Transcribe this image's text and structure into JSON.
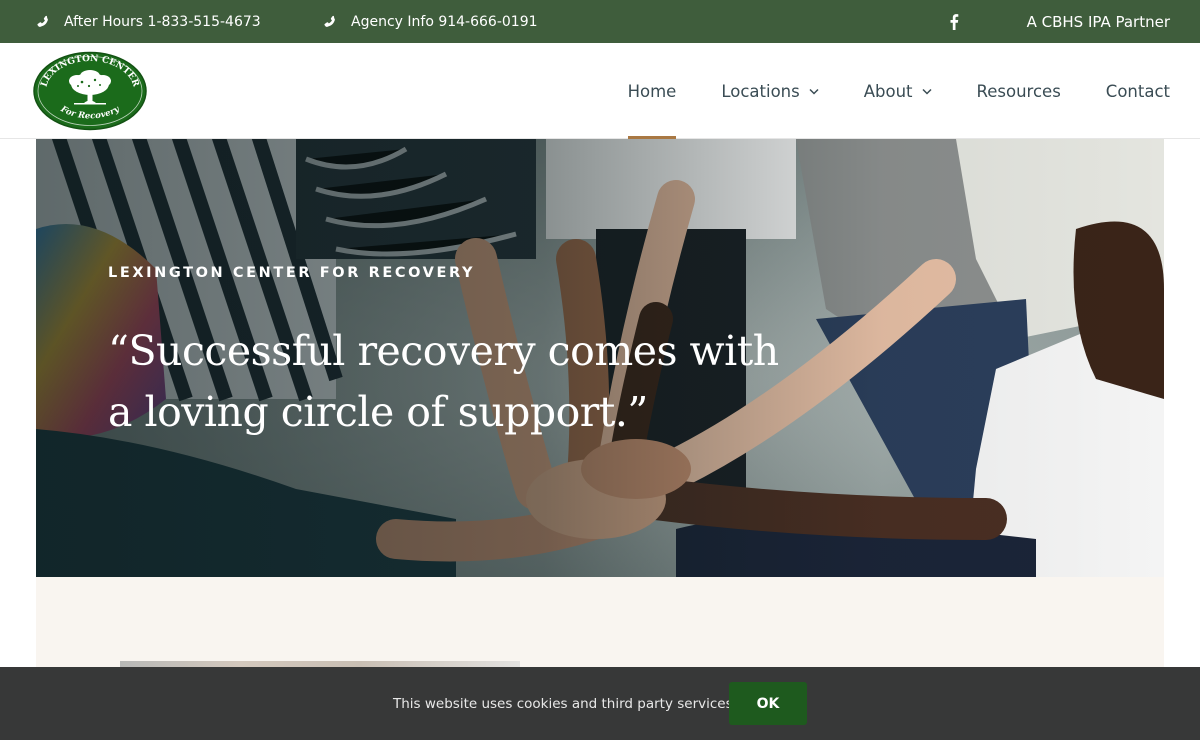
{
  "topbar": {
    "after_hours": "After Hours 1-833-515-4673",
    "agency_info": "Agency Info 914-666-0191",
    "partner": "A CBHS IPA Partner",
    "icons": [
      "phone-icon",
      "phone-icon",
      "facebook-icon"
    ]
  },
  "logo": {
    "top_text": "LEXINGTON CENTER",
    "bottom_text": "For Recovery"
  },
  "nav": {
    "items": [
      {
        "label": "Home",
        "active": true,
        "dropdown": false
      },
      {
        "label": "Locations",
        "active": false,
        "dropdown": true
      },
      {
        "label": "About",
        "active": false,
        "dropdown": true
      },
      {
        "label": "Resources",
        "active": false,
        "dropdown": false
      },
      {
        "label": "Contact",
        "active": false,
        "dropdown": false
      }
    ]
  },
  "hero": {
    "kicker": "LEXINGTON CENTER FOR RECOVERY",
    "quote_line1": "“Successful recovery comes with",
    "quote_line2": "a loving circle of support.”"
  },
  "cookie": {
    "message": "This website uses cookies and third party services.",
    "ok_label": "OK"
  },
  "colors": {
    "topbar_bg": "#3f5d3c",
    "nav_text": "#3a4c54",
    "nav_active_underline": "#a97843",
    "logo_green": "#1b6b1b",
    "beige_bg": "#f9f5f0",
    "cookie_bg": "#373838",
    "ok_button": "#1e5a1e"
  }
}
